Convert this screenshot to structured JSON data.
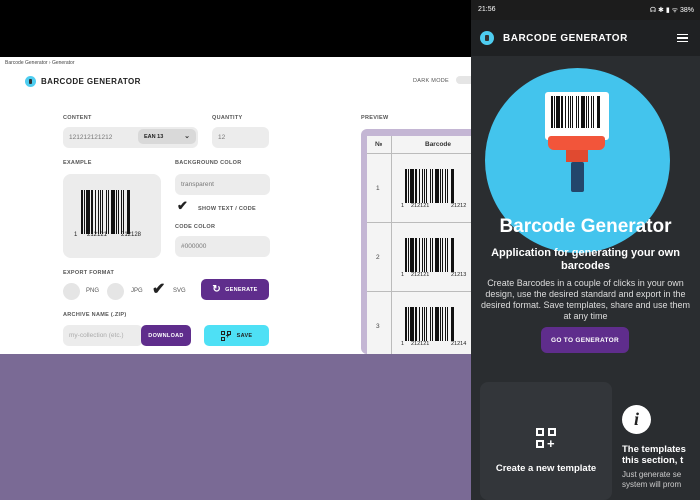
{
  "desktop": {
    "breadcrumb": "Barcode Generator › Generator",
    "app_title": "BARCODE GENERATOR",
    "dark_mode_label": "DARK MODE",
    "content_label": "CONTENT",
    "content_value": "121212121212",
    "format_selected": "EAN 13",
    "quantity_label": "QUANTITY",
    "quantity_value": "12",
    "example_label": "EXAMPLE",
    "example_digits": {
      "first": "1",
      "left": "212121",
      "right": "212128"
    },
    "bg_color_label": "BACKGROUND COLOR",
    "bg_color_value": "transparent",
    "show_text_label": "SHOW TEXT / CODE",
    "code_color_label": "CODE COLOR",
    "code_color_value": "#000000",
    "export_format_label": "EXPORT FORMAT",
    "formats": [
      "PNG",
      "JPG",
      "SVG"
    ],
    "selected_format": "SVG",
    "generate_label": "GENERATE",
    "archive_label": "ARCHIVE NAME (.ZIP)",
    "archive_placeholder": "my-collection (etc.)",
    "download_label": "DOWNLOAD",
    "save_label": "SAVE",
    "preview_label": "PREVIEW",
    "preview_table": {
      "col_num": "№",
      "col_barcode": "Barcode",
      "rows": [
        {
          "n": "1",
          "first": "1",
          "left": "212121",
          "right": "21212"
        },
        {
          "n": "2",
          "first": "1",
          "left": "212121",
          "right": "21213"
        },
        {
          "n": "3",
          "first": "1",
          "left": "212121",
          "right": "21214"
        }
      ]
    }
  },
  "phone": {
    "status_time": "21:56",
    "status_icons": "☊ ✱ ▮ ᯤ 38%",
    "app_title": "BARCODE GENERATOR",
    "hero_title": "Barcode Generator",
    "hero_subtitle": "Application for generating your own barcodes",
    "hero_body": "Create Barcodes in a couple of clicks in your own design, use the desired standard and export in the desired format. Save templates, share and use them at any time",
    "go_button": "GO TO GENERATOR",
    "card_new_template": "Create a new template",
    "info_title_1": "The templates",
    "info_title_2": "this section, t",
    "info_body_1": "Just generate se",
    "info_body_2": "system will prom"
  },
  "colors": {
    "accent_purple": "#5f2d8c",
    "accent_cyan": "#4ee0f5",
    "background_purple": "#7a6a95",
    "phone_bg": "#2a2d30"
  }
}
